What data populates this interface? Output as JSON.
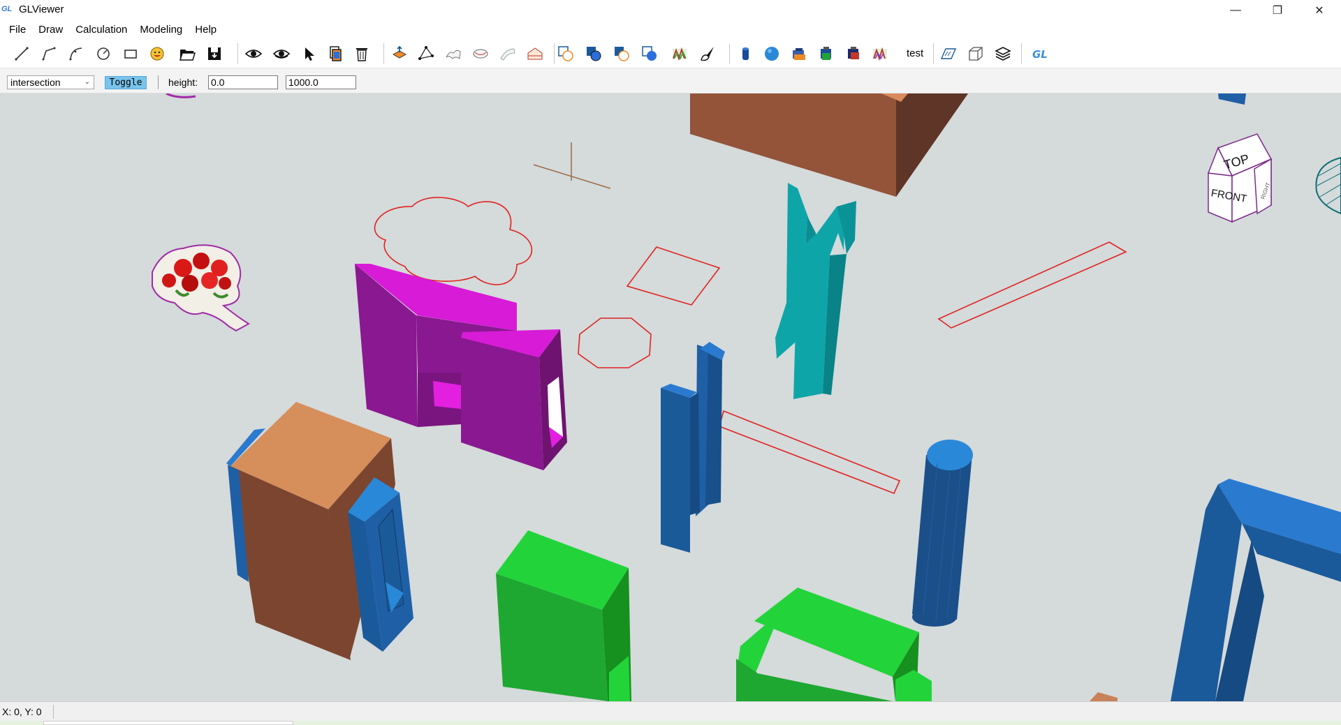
{
  "window": {
    "logo": "GL",
    "title": "GLViewer",
    "minimize": "—",
    "maximize": "❐",
    "close": "✕"
  },
  "menu": [
    "File",
    "Draw",
    "Calculation",
    "Modeling",
    "Help"
  ],
  "toolbar": {
    "text_button": "test"
  },
  "options": {
    "operation_value": "intersection",
    "toggle_label": "Toggle",
    "height_label": "height:",
    "height_min": "0.0",
    "height_max": "1000.0"
  },
  "view_cube": {
    "top": "TOP",
    "front": "FRONT",
    "right": "RIGHT"
  },
  "status": {
    "coordinates": "X: 0, Y: 0"
  },
  "colors": {
    "viewport_bg": "#d5dadb",
    "magenta": "#8a1891",
    "cyan": "#0ea5a8",
    "blue": "#1a5a9a",
    "green": "#22d43a",
    "brown": "#7c4530",
    "sketch": "#e0231f"
  }
}
